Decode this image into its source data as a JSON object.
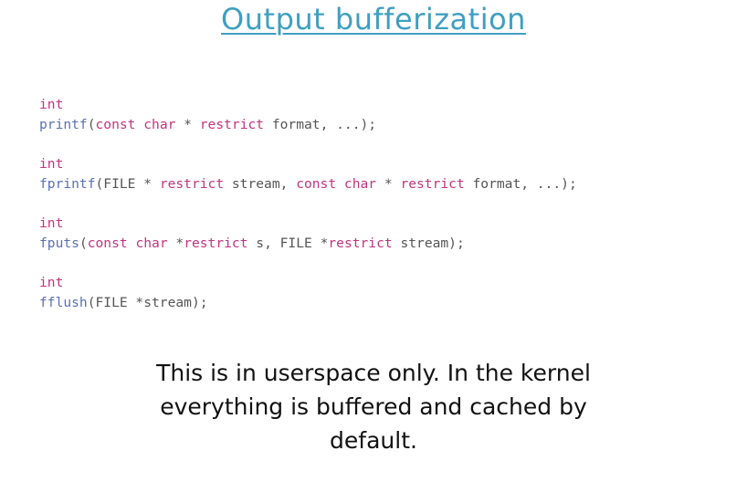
{
  "title": "Output bufferization",
  "code_blocks": [
    {
      "return_type": "int",
      "signature": [
        {
          "t": "printf",
          "c": "fn"
        },
        {
          "t": "(",
          "c": "tx"
        },
        {
          "t": "const",
          "c": "kw"
        },
        {
          "t": " ",
          "c": "tx"
        },
        {
          "t": "char",
          "c": "kw"
        },
        {
          "t": " * ",
          "c": "tx"
        },
        {
          "t": "restrict",
          "c": "kw"
        },
        {
          "t": " format, ...);",
          "c": "tx"
        }
      ]
    },
    {
      "return_type": "int",
      "signature": [
        {
          "t": "fprintf",
          "c": "fn"
        },
        {
          "t": "(FILE * ",
          "c": "tx"
        },
        {
          "t": "restrict",
          "c": "kw"
        },
        {
          "t": " stream, ",
          "c": "tx"
        },
        {
          "t": "const",
          "c": "kw"
        },
        {
          "t": " ",
          "c": "tx"
        },
        {
          "t": "char",
          "c": "kw"
        },
        {
          "t": " * ",
          "c": "tx"
        },
        {
          "t": "restrict",
          "c": "kw"
        },
        {
          "t": " format, ...);",
          "c": "tx"
        }
      ]
    },
    {
      "return_type": "int",
      "signature": [
        {
          "t": "fputs",
          "c": "fn"
        },
        {
          "t": "(",
          "c": "tx"
        },
        {
          "t": "const",
          "c": "kw"
        },
        {
          "t": " ",
          "c": "tx"
        },
        {
          "t": "char",
          "c": "kw"
        },
        {
          "t": " *",
          "c": "tx"
        },
        {
          "t": "restrict",
          "c": "kw"
        },
        {
          "t": " s, FILE *",
          "c": "tx"
        },
        {
          "t": "restrict",
          "c": "kw"
        },
        {
          "t": " stream);",
          "c": "tx"
        }
      ]
    },
    {
      "return_type": "int",
      "signature": [
        {
          "t": "fflush",
          "c": "fn"
        },
        {
          "t": "(FILE *stream);",
          "c": "tx"
        }
      ]
    }
  ],
  "note_lines": [
    "This is in userspace only. In the kernel",
    "everything is buffered and cached by",
    "default."
  ],
  "colors": {
    "title": "#3f9fc0",
    "keyword": "#c2347f",
    "function": "#5b6fb3",
    "plain": "#555555"
  }
}
